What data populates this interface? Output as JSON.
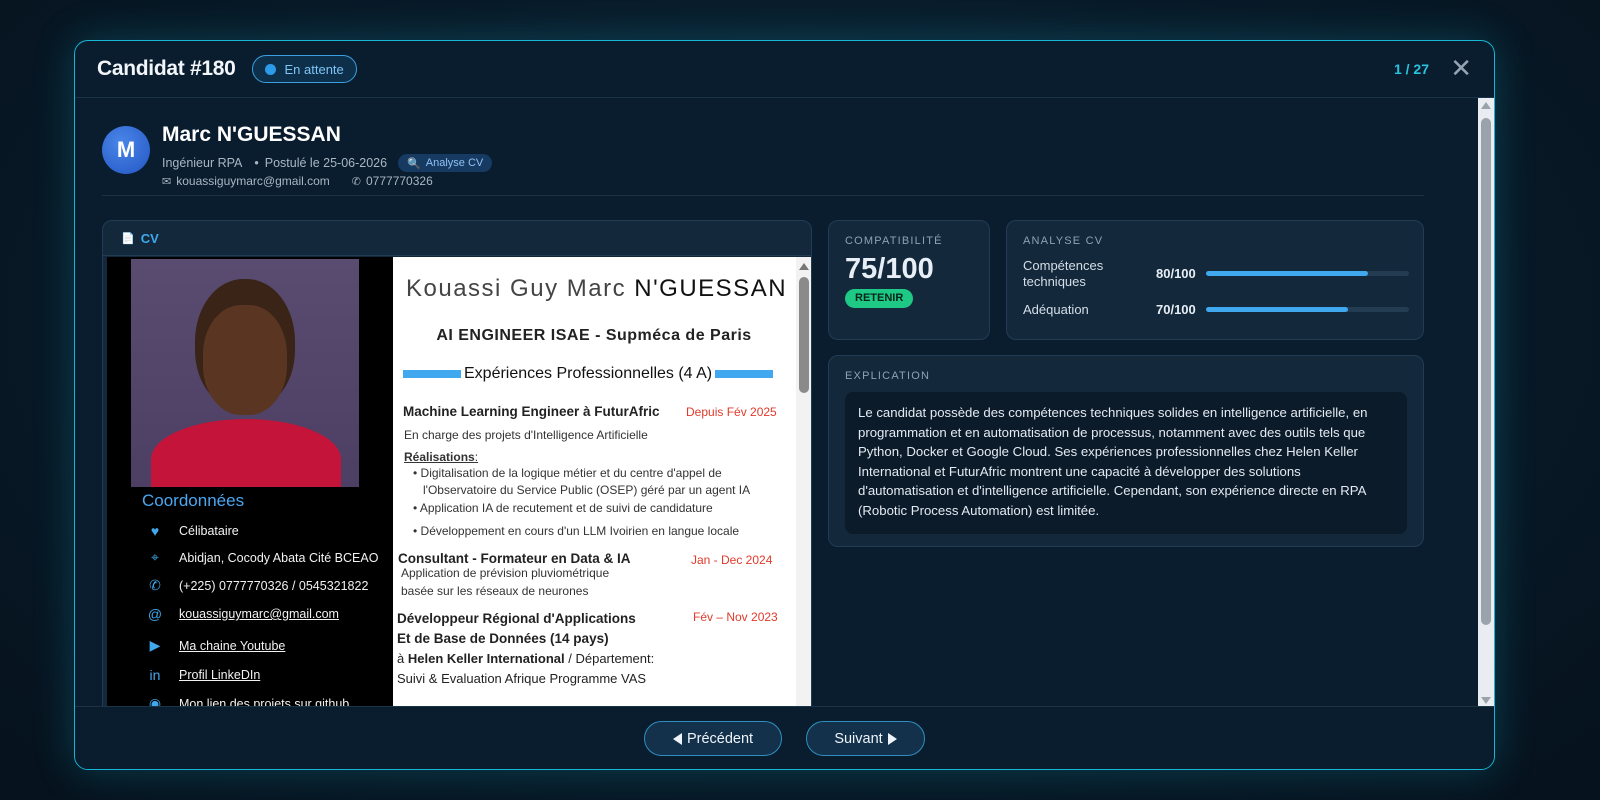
{
  "modal": {
    "title": "Candidat #180",
    "status": "En attente",
    "page_counter": "1 / 27",
    "close_symbol": "✕"
  },
  "candidate": {
    "initial": "M",
    "name": "Marc N'GUESSAN",
    "role": "Ingénieur RPA",
    "applied": "Postulé le 25-06-2026",
    "tag": "Analyse CV",
    "email": "kouassiguymarc@gmail.com",
    "phone": "0777770326"
  },
  "cv": {
    "label": "CV",
    "name_first": "Kouassi Guy Marc",
    "name_last": "N'GUESSAN",
    "headline": "AI ENGINEER  ISAE - Supméca de Paris",
    "section_title": "Expériences Professionnelles (4 A)",
    "coord_title": "Coordonnées",
    "coords": [
      {
        "icon": "heart-icon",
        "text": "Célibataire"
      },
      {
        "icon": "location-pin-icon",
        "text": "Abidjan, Cocody Abata Cité BCEAO"
      },
      {
        "icon": "phone-icon",
        "text": "(+225) 0777770326 / 0545321822"
      },
      {
        "icon": "at-icon",
        "text": "kouassiguymarc@gmail.com"
      },
      {
        "icon": "youtube-icon",
        "text": "Ma chaine Youtube"
      },
      {
        "icon": "linkedin-icon",
        "text": "Profil LinkeDIn"
      },
      {
        "icon": "github-icon",
        "text": "Mon lien des projets sur github"
      }
    ],
    "job1_title": "Machine Learning Engineer à FuturAfric",
    "job1_date": "Depuis Fév 2025",
    "job1_desc": "En charge des projets d'Intelligence Artificielle",
    "job1_realisations": "Réalisations",
    "job1_bullets": [
      "Digitalisation de la logique métier et du centre d'appel de",
      "l'Observatoire du Service Public (OSEP) géré par un agent IA",
      "Application IA de recutement et de suivi de candidature",
      "Développement en cours d'un LLM Ivoirien en langue locale"
    ],
    "job2_title": "Consultant - Formateur en Data & IA",
    "job2_date": "Jan - Dec 2024",
    "job2_desc1": "Application de prévision pluviométrique",
    "job2_desc2": "basée sur les réseaux de neurones",
    "job3_title1": "Développeur Régional d'Applications",
    "job3_title2": "Et de Base de Données (14 pays)",
    "job3_date": "Fév – Nov 2023",
    "job3_at": "à",
    "job3_org": "Helen Keller International",
    "job3_dept": "/ Département:",
    "job3_dept2": "Suivi & Evaluation Afrique Programme VAS"
  },
  "compatibility": {
    "label": "COMPATIBILITÉ",
    "score": "75/100",
    "decision": "RETENIR"
  },
  "analysis": {
    "label": "ANALYSE CV",
    "metrics": [
      {
        "label": "Compétences techniques",
        "value": "80/100",
        "fraction": 0.8
      },
      {
        "label": "Adéquation",
        "value": "70/100",
        "fraction": 0.7
      }
    ]
  },
  "explanation": {
    "label": "EXPLICATION",
    "text": "Le candidat possède des compétences techniques solides en intelligence artificielle, en programmation et en automatisation de processus, notamment avec des outils tels que Python, Docker et Google Cloud. Ses expériences professionnelles chez Helen Keller International et FuturAfric montrent une capacité à développer des solutions d'automatisation et d'intelligence artificielle. Cependant, son expérience directe en RPA (Robotic Process Automation) est limitée."
  },
  "footer": {
    "prev_label": "Précédent",
    "next_label": "Suivant"
  },
  "colors": {
    "accent": "#18b6d6",
    "primary": "#3fa8ee",
    "success": "#1ec885",
    "date_red": "#e03a2a"
  }
}
